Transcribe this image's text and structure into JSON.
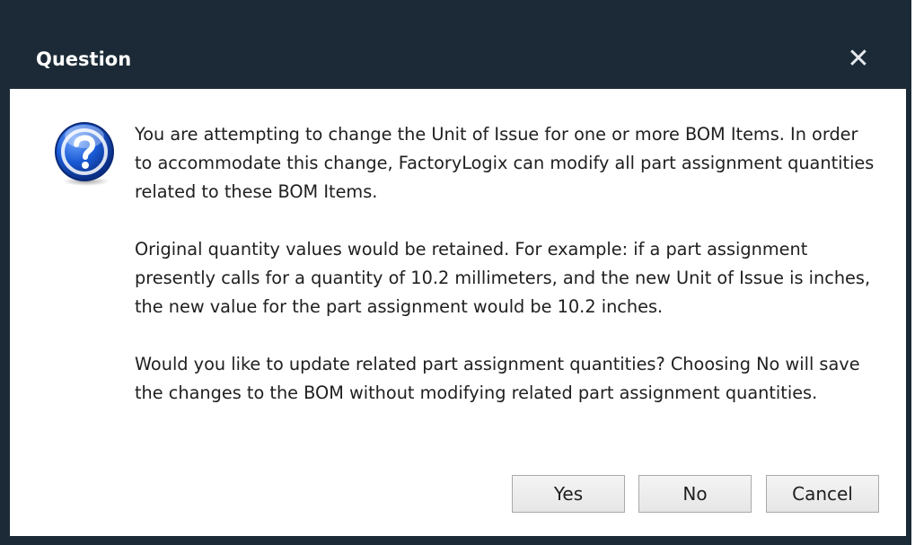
{
  "dialog": {
    "title": "Question",
    "close_glyph": "✕",
    "icon": "question-icon",
    "paragraphs": [
      "You are attempting to change the Unit of Issue for one or more BOM Items. In order to accommodate this change, FactoryLogix can modify all part assignment quantities related to these BOM Items.",
      "Original quantity values would be retained. For example: if a part assignment presently calls for a quantity of 10.2 millimeters, and the new Unit of Issue is inches, the new value for the part assignment would be 10.2 inches.",
      "Would you like to update related part assignment quantities? Choosing No will save the changes to the BOM without modifying related part assignment quantities."
    ],
    "buttons": {
      "yes": "Yes",
      "no": "No",
      "cancel": "Cancel"
    }
  },
  "colors": {
    "frame": "#1b2a36",
    "icon_blue": "#1a5bd6"
  }
}
